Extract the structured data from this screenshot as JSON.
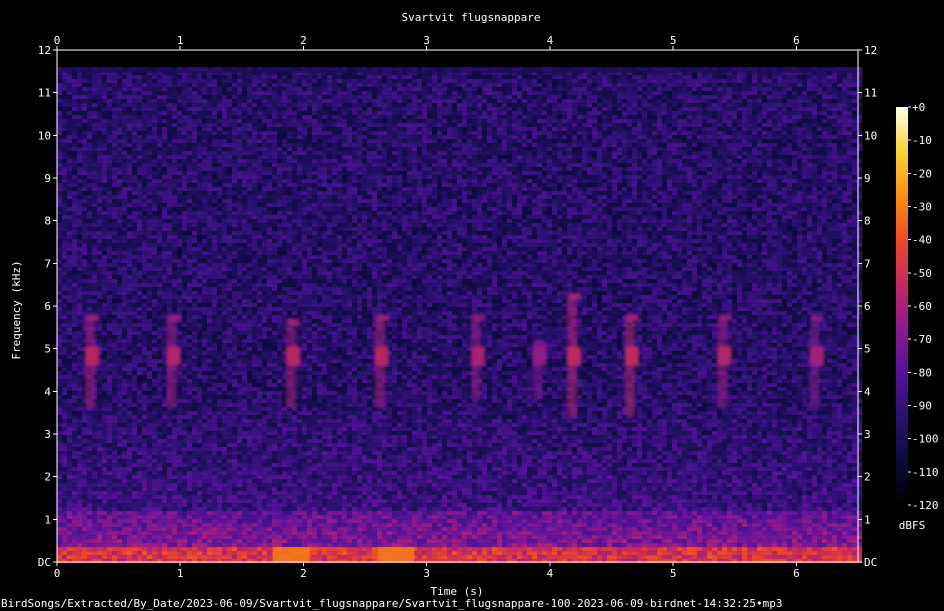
{
  "chart_data": {
    "type": "heatmap",
    "title": "Svartvit flugsnappare",
    "xlabel": "Time (s)",
    "ylabel": "Frequency (kHz)",
    "xlim": [
      0,
      6.5
    ],
    "ylim": [
      0,
      12
    ],
    "x_ticks": [
      "0",
      "1",
      "2",
      "3",
      "4",
      "5",
      "6"
    ],
    "y_ticks": [
      "DC",
      "1",
      "2",
      "3",
      "4",
      "5",
      "6",
      "7",
      "8",
      "9",
      "10",
      "11",
      "12"
    ],
    "colorbar": {
      "label": "dBFS",
      "range": [
        -120,
        0
      ],
      "ticks": [
        "+0",
        "-10",
        "-20",
        "-30",
        "-40",
        "-50",
        "-60",
        "-70",
        "-80",
        "-90",
        "-100",
        "-110",
        "-120"
      ]
    },
    "calls": [
      {
        "t": 0.27,
        "f_low": 3.6,
        "f_high": 5.8,
        "db": -60
      },
      {
        "t": 0.93,
        "f_low": 3.6,
        "f_high": 5.8,
        "db": -62
      },
      {
        "t": 1.9,
        "f_low": 3.6,
        "f_high": 5.7,
        "db": -60
      },
      {
        "t": 2.62,
        "f_low": 3.6,
        "f_high": 5.8,
        "db": -60
      },
      {
        "t": 3.4,
        "f_low": 3.8,
        "f_high": 5.8,
        "db": -64
      },
      {
        "t": 3.9,
        "f_low": 3.8,
        "f_high": 5.2,
        "db": -70
      },
      {
        "t": 4.18,
        "f_low": 3.4,
        "f_high": 6.3,
        "db": -58
      },
      {
        "t": 4.65,
        "f_low": 3.4,
        "f_high": 5.8,
        "db": -58
      },
      {
        "t": 5.4,
        "f_low": 3.6,
        "f_high": 5.8,
        "db": -62
      },
      {
        "t": 6.15,
        "f_low": 3.6,
        "f_high": 5.8,
        "db": -66
      }
    ],
    "noise_floor_db": -95,
    "low_band": {
      "f_low": 0,
      "f_high": 1.2,
      "db": -65
    },
    "cutoff_khz": 11.6
  },
  "footer_path": "BirdSongs/Extracted/By_Date/2023-06-09/Svartvit_flugsnappare/Svartvit_flugsnappare-100-2023-06-09-birdnet-14:32:25•mp3",
  "colors": {
    "background": "#000000",
    "colormap": [
      "#000000",
      "#0b0a3a",
      "#2a1170",
      "#55139a",
      "#8a1a90",
      "#c42a60",
      "#ec4a2a",
      "#fb8f12",
      "#f8d43a",
      "#ffffe6"
    ]
  }
}
